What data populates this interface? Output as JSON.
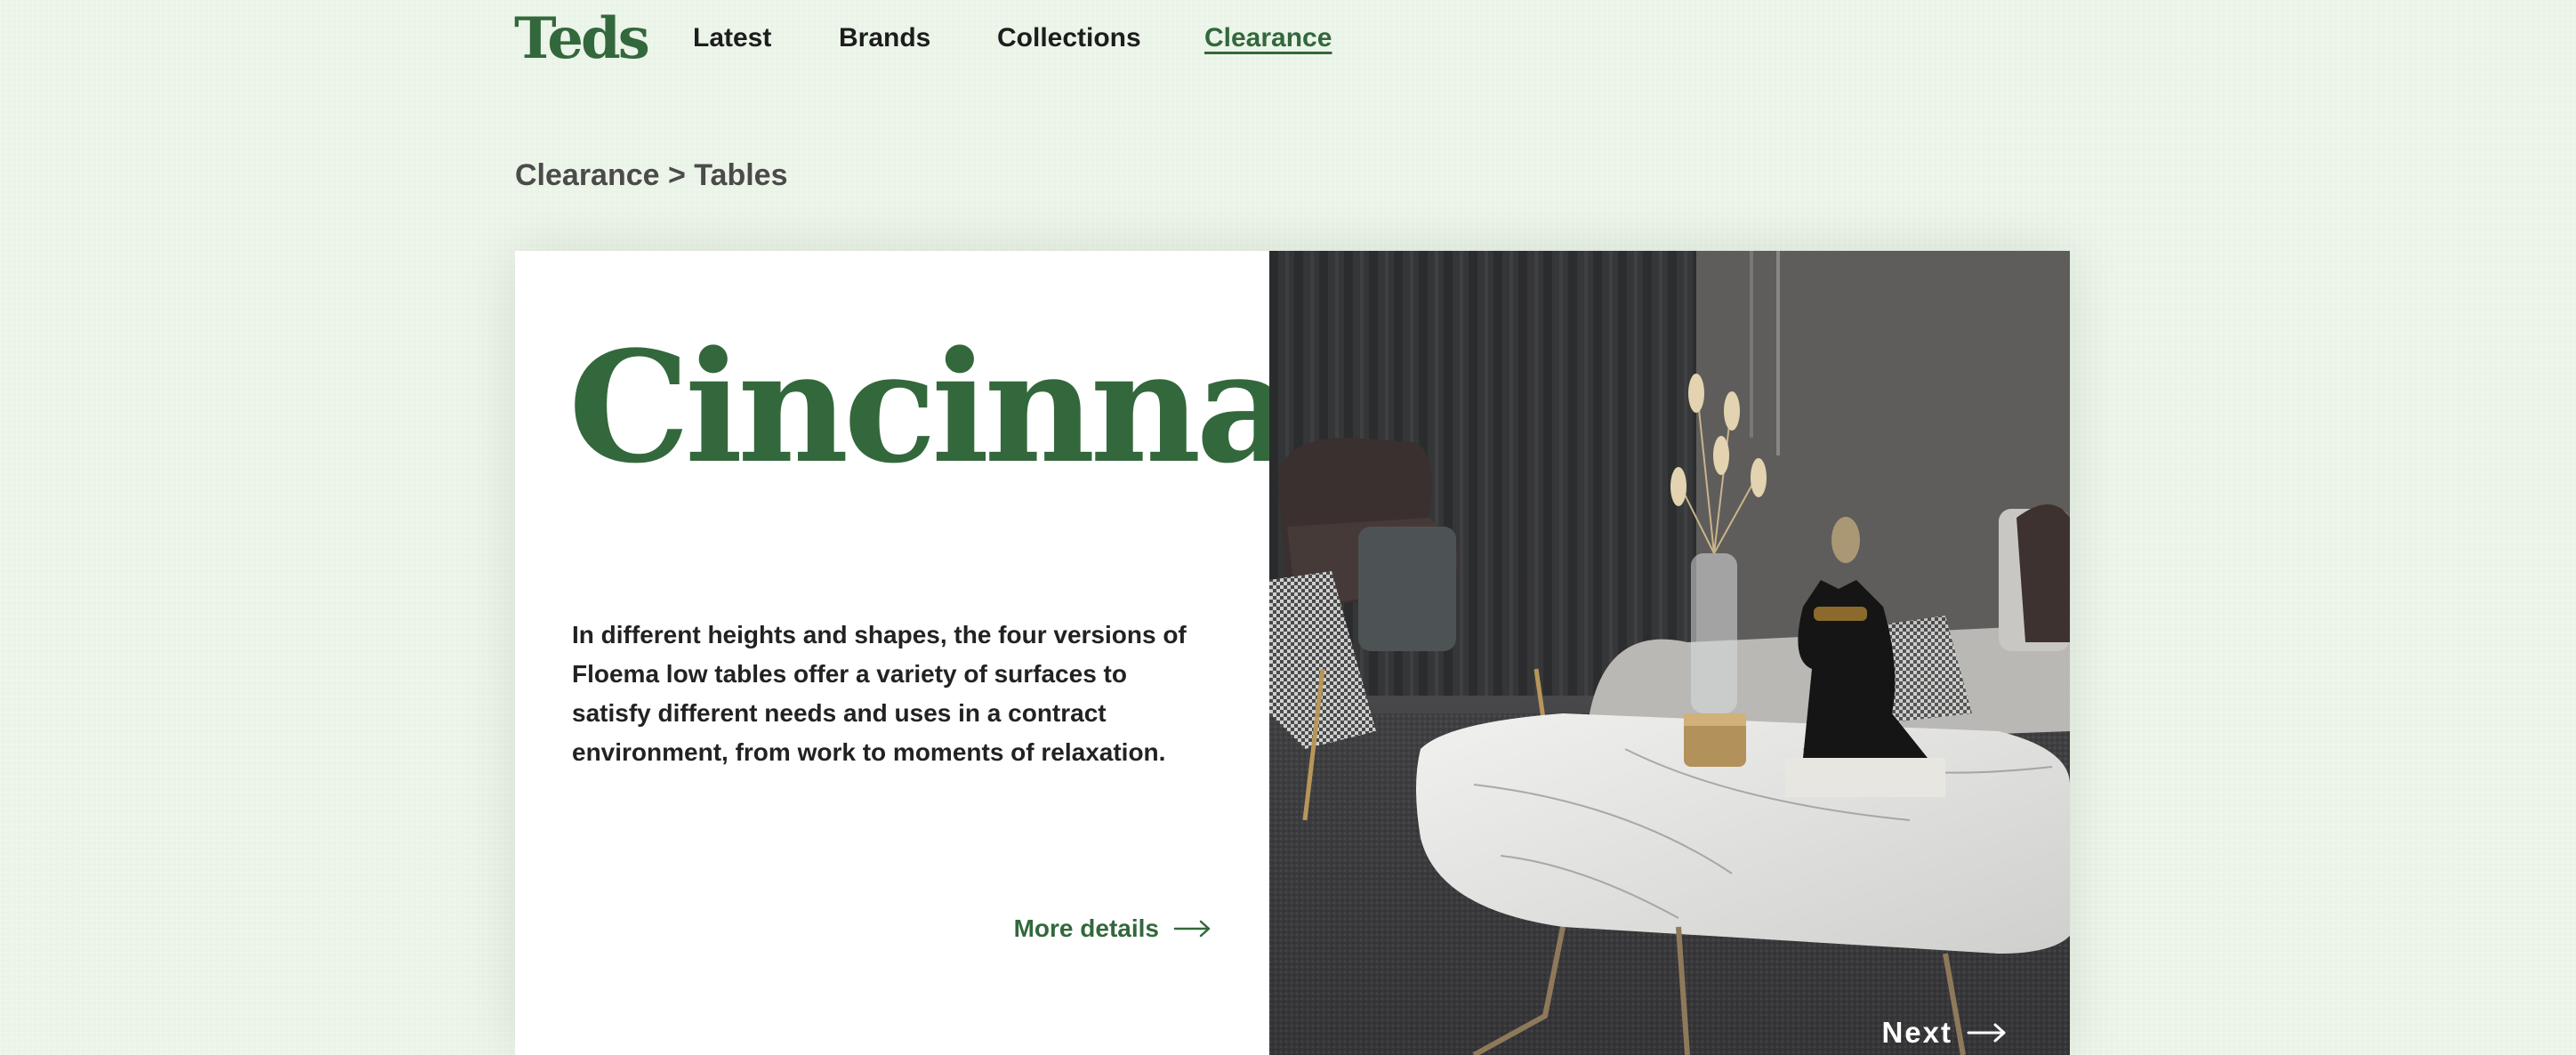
{
  "brand": {
    "logo": "Teds"
  },
  "nav": {
    "items": [
      {
        "label": "Latest"
      },
      {
        "label": "Brands"
      },
      {
        "label": "Collections"
      },
      {
        "label": "Clearance",
        "active": true
      }
    ]
  },
  "breadcrumb": "Clearance > Tables",
  "product": {
    "title": "Cincinnati",
    "description": "In different heights and shapes, the four versions of Floema low tables offer a variety of surfaces to satisfy different needs and uses in a contract environment, from work to moments of relaxation.",
    "more_label": "More details",
    "next_label": "Next"
  },
  "colors": {
    "accent": "#33683c",
    "background": "#e9f3e6"
  },
  "icons": {
    "more": "arrow-right-icon",
    "next": "arrow-right-icon"
  }
}
